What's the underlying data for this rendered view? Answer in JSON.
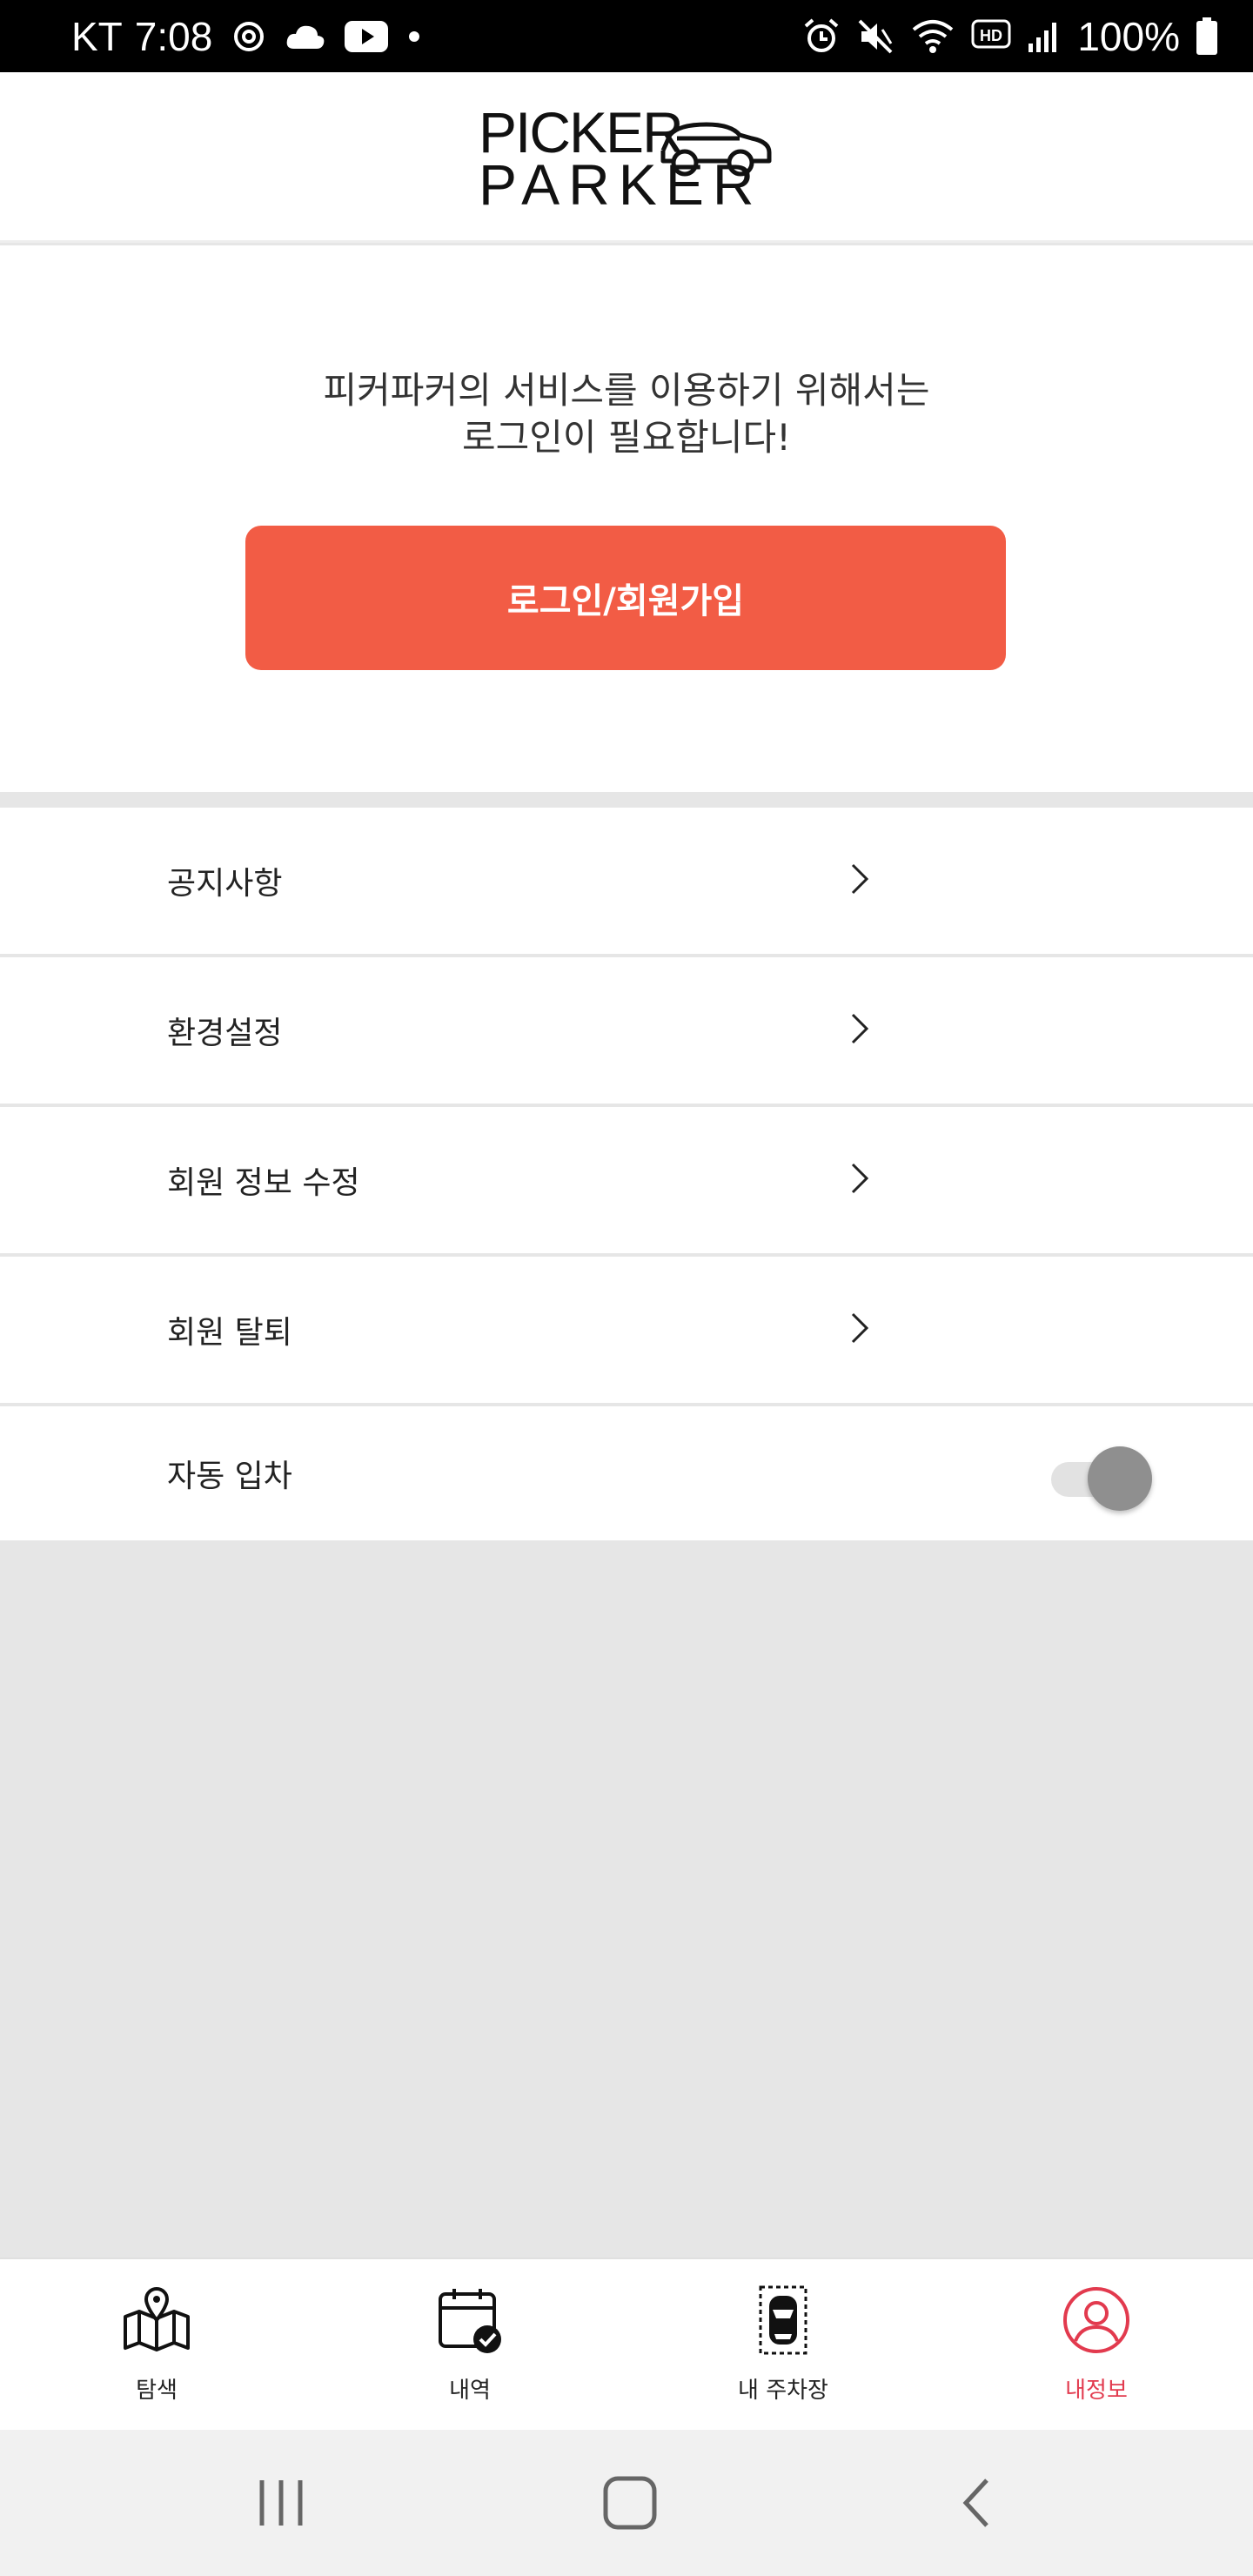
{
  "status_bar": {
    "carrier": "KT",
    "time": "7:08",
    "battery": "100%",
    "icons_left": [
      "sync-icon",
      "cloud-icon",
      "youtube-icon",
      "dot-icon"
    ],
    "icons_right": [
      "alarm-icon",
      "mute-icon",
      "wifi-icon",
      "hd-icon",
      "signal-icon",
      "battery-icon"
    ]
  },
  "header": {
    "logo_line1": "PICKER",
    "logo_line2": "PARKER"
  },
  "login": {
    "message_line1": "피커파커의 서비스를 이용하기 위해서는",
    "message_line2": "로그인이 필요합니다!",
    "button_label": "로그인/회원가입"
  },
  "menu": {
    "items": [
      {
        "label": "공지사항"
      },
      {
        "label": "환경설정"
      },
      {
        "label": "회원 정보 수정"
      },
      {
        "label": "회원 탈퇴"
      }
    ],
    "auto_entry": {
      "label": "자동 입차",
      "enabled": false
    }
  },
  "bottom_nav": {
    "items": [
      {
        "label": "탐색",
        "icon": "map-pin-icon",
        "active": false
      },
      {
        "label": "내역",
        "icon": "calendar-check-icon",
        "active": false
      },
      {
        "label": "내 주차장",
        "icon": "parking-car-icon",
        "active": false
      },
      {
        "label": "내정보",
        "icon": "user-icon",
        "active": true
      }
    ]
  },
  "colors": {
    "accent": "#f25c45",
    "active_tab": "#e23a4e",
    "background": "#e6e6e6"
  }
}
